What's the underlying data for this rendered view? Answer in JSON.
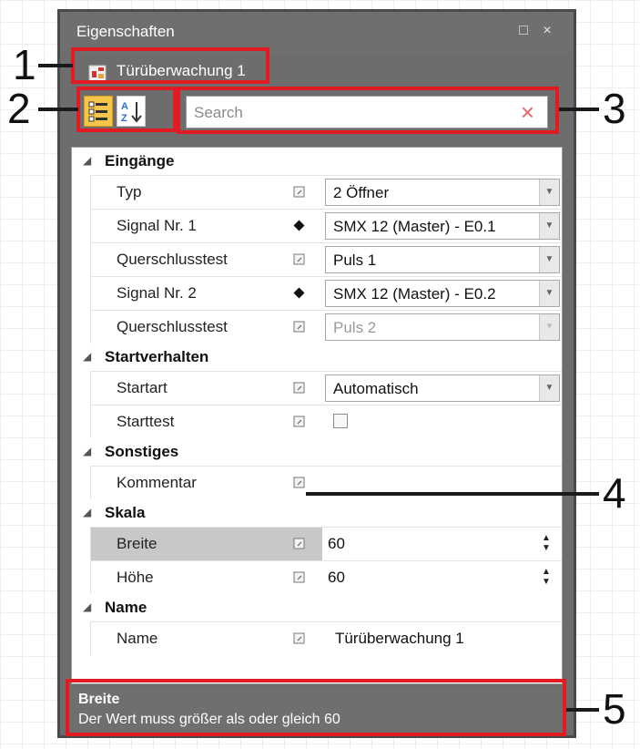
{
  "panel": {
    "title": "Eigenschaften",
    "window_buttons": {
      "restore": "□",
      "close": "×"
    },
    "object_name": "Türüberwachung 1"
  },
  "toolbar": {
    "categorized_icon": "categorized-view-icon",
    "alphabetical_icon": "sort-az-icon",
    "search_placeholder": "Search",
    "clear_icon": "×"
  },
  "grid": {
    "categories": [
      {
        "label": "Eingänge",
        "rows": [
          {
            "name": "Typ",
            "value": "2 Öffner",
            "editor": "combo"
          },
          {
            "name": "Signal Nr. 1",
            "value": "SMX 12 (Master) - E0.1",
            "editor": "combo"
          },
          {
            "name": "Querschlusstest",
            "value": "Puls 1",
            "editor": "combo"
          },
          {
            "name": "Signal Nr. 2",
            "value": "SMX 12 (Master) - E0.2",
            "editor": "combo"
          },
          {
            "name": "Querschlusstest",
            "value": "Puls 2",
            "editor": "combo-disabled"
          }
        ]
      },
      {
        "label": "Startverhalten",
        "rows": [
          {
            "name": "Startart",
            "value": "Automatisch",
            "editor": "combo"
          },
          {
            "name": "Starttest",
            "value": "",
            "editor": "checkbox"
          }
        ]
      },
      {
        "label": "Sonstiges",
        "rows": [
          {
            "name": "Kommentar",
            "value": "",
            "editor": "text"
          }
        ]
      },
      {
        "label": "Skala",
        "rows": [
          {
            "name": "Breite",
            "value": "60",
            "editor": "spin",
            "selected": true
          },
          {
            "name": "Höhe",
            "value": "60",
            "editor": "spin"
          }
        ]
      },
      {
        "label": "Name",
        "rows": [
          {
            "name": "Name",
            "value": "Türüberwachung 1",
            "editor": "text"
          }
        ]
      }
    ]
  },
  "description": {
    "title": "Breite",
    "text": "Der Wert muss größer als oder gleich 60"
  },
  "callouts": [
    "1",
    "2",
    "3",
    "4",
    "5"
  ],
  "colors": {
    "callout": "#e21b23",
    "panel": "#6d6d6d"
  }
}
